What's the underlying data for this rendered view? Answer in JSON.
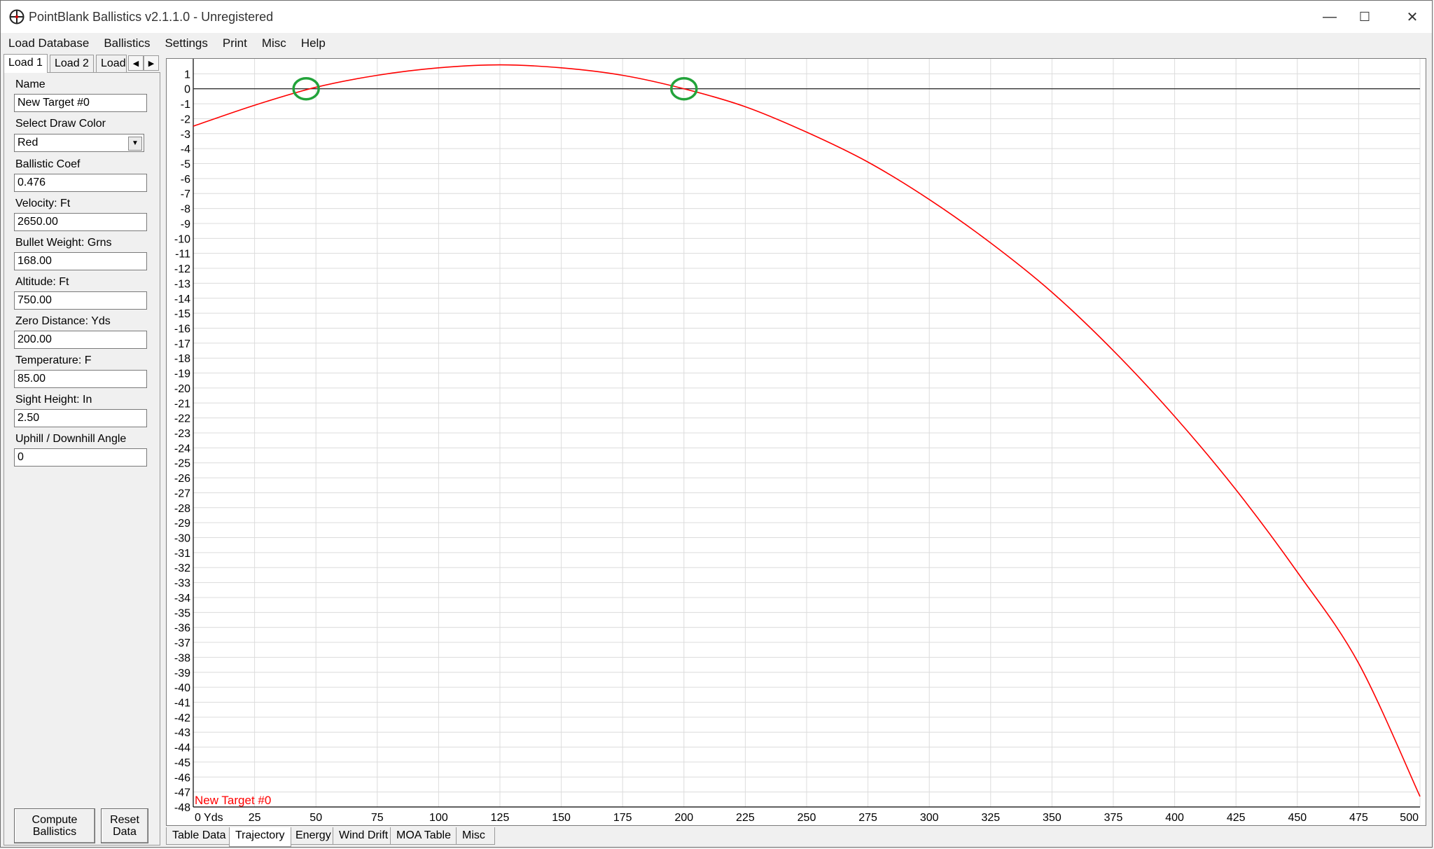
{
  "window": {
    "title": "PointBlank Ballistics v2.1.1.0 - Unregistered",
    "minimize": "—",
    "maximize": "☐",
    "close": "✕"
  },
  "menu": [
    "Load Database",
    "Ballistics",
    "Settings",
    "Print",
    "Misc",
    "Help"
  ],
  "load_tabs": [
    "Load 1",
    "Load 2",
    "Load"
  ],
  "load_tab_arrows": {
    "left": "◀",
    "right": "▶"
  },
  "fields": {
    "name_label": "Name",
    "name_value": "New Target #0",
    "color_label": "Select Draw Color",
    "color_value": "Red",
    "color_arrow": "▼",
    "bc_label": "Ballistic Coef",
    "bc_value": "0.476",
    "velocity_label": "Velocity: Ft",
    "velocity_value": "2650.00",
    "weight_label": "Bullet Weight: Grns",
    "weight_value": "168.00",
    "altitude_label": "Altitude: Ft",
    "altitude_value": "750.00",
    "zero_label": "Zero Distance: Yds",
    "zero_value": "200.00",
    "temp_label": "Temperature: F",
    "temp_value": "85.00",
    "sight_label": "Sight Height: In",
    "sight_value": "2.50",
    "angle_label": "Uphill / Downhill Angle",
    "angle_value": "0"
  },
  "buttons": {
    "compute_line1": "Compute",
    "compute_line2": "Ballistics",
    "reset_line1": "Reset",
    "reset_line2": "Data"
  },
  "bottom_tabs": [
    "Table Data",
    "Trajectory",
    "Energy",
    "Wind Drift",
    "MOA Table",
    "Misc"
  ],
  "active_bottom_tab": "Trajectory",
  "chart_data": {
    "type": "line",
    "series": [
      {
        "name": "New Target #0",
        "color": "#ff0000",
        "x": [
          0,
          25,
          50,
          75,
          100,
          125,
          150,
          175,
          200,
          225,
          250,
          275,
          300,
          325,
          350,
          375,
          400,
          425,
          450,
          475,
          500
        ],
        "y": [
          -2.5,
          -1.1,
          0.1,
          0.9,
          1.4,
          1.6,
          1.4,
          0.9,
          0.0,
          -1.2,
          -2.9,
          -4.9,
          -7.4,
          -10.3,
          -13.6,
          -17.5,
          -21.9,
          -26.8,
          -32.3,
          -38.4,
          -47.3
        ]
      }
    ],
    "x_tick_labels": [
      "0 Yds",
      "25",
      "50",
      "75",
      "100",
      "125",
      "150",
      "175",
      "200",
      "225",
      "250",
      "275",
      "300",
      "325",
      "350",
      "375",
      "400",
      "425",
      "450",
      "475",
      "500"
    ],
    "xlim": [
      0,
      500
    ],
    "ylim": [
      -48,
      2
    ],
    "y_ticks_from": -48,
    "y_ticks_to": 1,
    "grid": true,
    "zero_crossings_highlighted": [
      46,
      200
    ],
    "highlight_color": "#22a33a",
    "legend_position": "bottom-left"
  }
}
